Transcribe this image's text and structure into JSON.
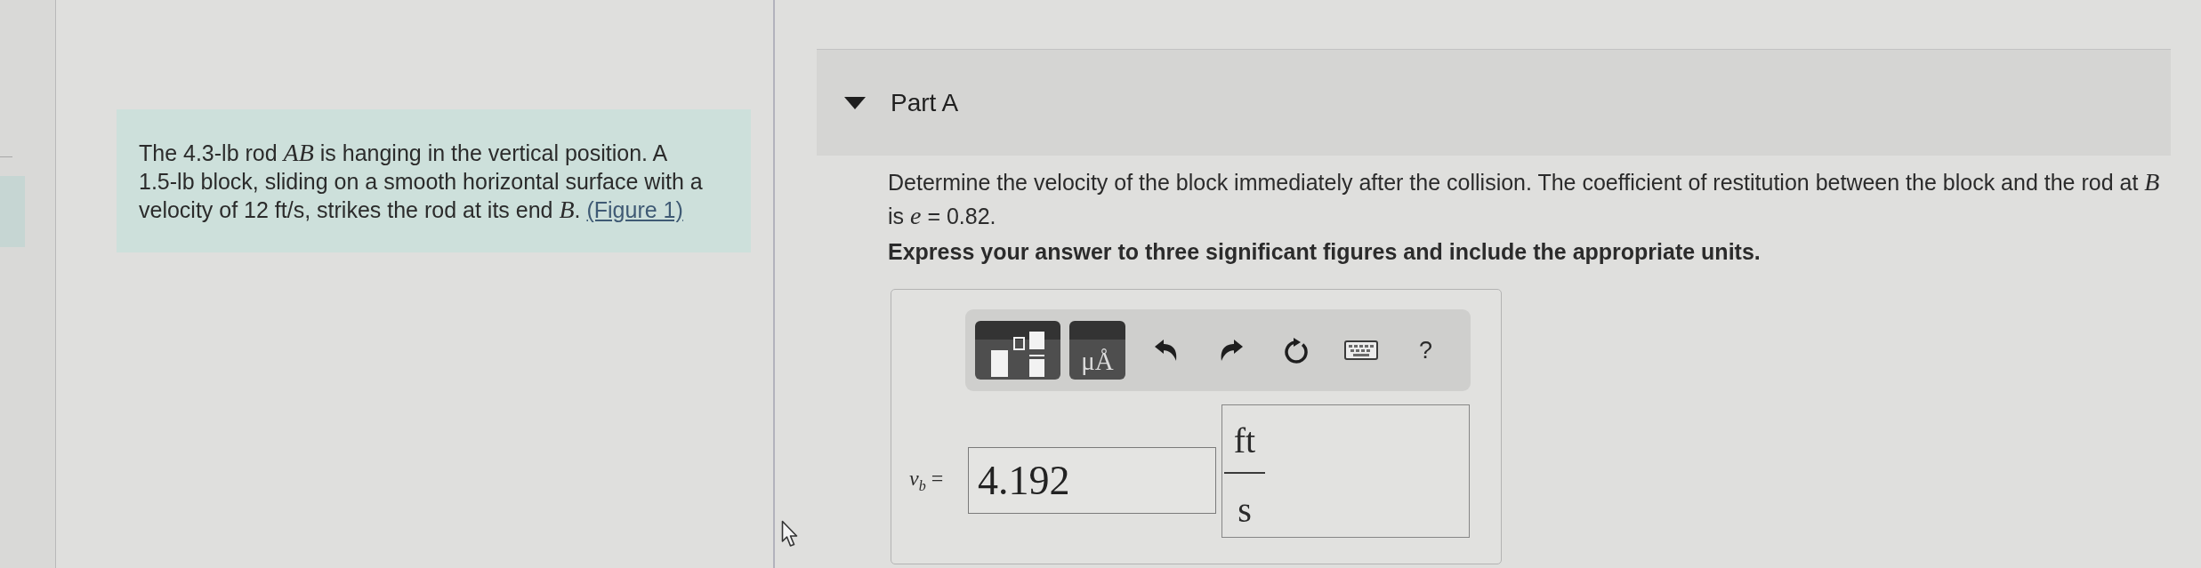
{
  "problem": {
    "text": "The 4.3-lb rod *AB* is hanging in the vertical position. A 1.5-lb block, sliding on a smooth horizontal surface with a velocity of 12 ft/s, strikes the rod at its end *B*.",
    "figure_link": "(Figure 1)"
  },
  "part": {
    "title": "Part A",
    "expanded": true,
    "question": "Determine the velocity of the block immediately after the collision. The coefficient of restitution between the block and the rod at *B* is *e* = 0.82.",
    "instruction": "Express your answer to three significant figures and include the appropriate units."
  },
  "answer": {
    "toolbar": {
      "units_button": "μÅ",
      "help_button": "?"
    },
    "label": "*v*$_{b}$ =",
    "value": "4.192",
    "units": {
      "numerator": "ft",
      "denominator": "s"
    }
  }
}
